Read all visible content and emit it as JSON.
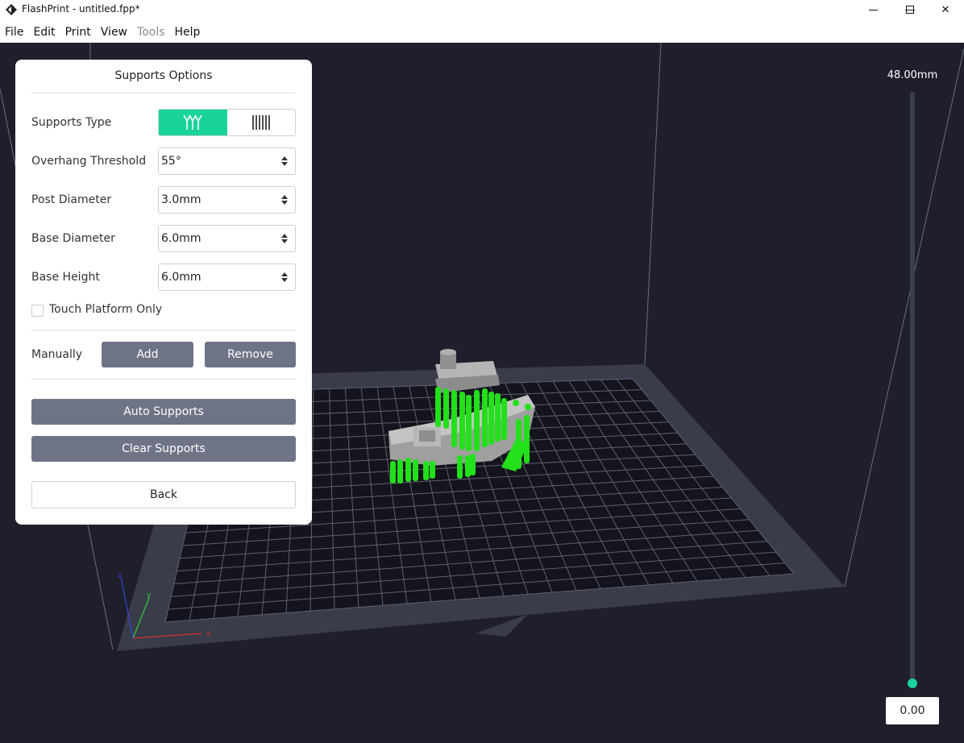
{
  "window": {
    "title": "FlashPrint - untitled.fpp*",
    "app_icon": "flashprint-logo-icon",
    "controls": {
      "minimize": "—",
      "maximize": "☐",
      "close": "✕"
    }
  },
  "menu": [
    {
      "label": "File",
      "enabled": true
    },
    {
      "label": "Edit",
      "enabled": true
    },
    {
      "label": "Print",
      "enabled": true
    },
    {
      "label": "View",
      "enabled": true
    },
    {
      "label": "Tools",
      "enabled": false
    },
    {
      "label": "Help",
      "enabled": true
    }
  ],
  "supports_panel": {
    "title": "Supports Options",
    "supports_type": {
      "label": "Supports Type",
      "options": [
        {
          "icon": "tree-supports-icon",
          "selected": true
        },
        {
          "icon": "linear-supports-icon",
          "selected": false
        }
      ]
    },
    "overhang_threshold": {
      "label": "Overhang Threshold",
      "value": "55°"
    },
    "post_diameter": {
      "label": "Post Diameter",
      "value": "3.0mm"
    },
    "base_diameter": {
      "label": "Base Diameter",
      "value": "6.0mm"
    },
    "base_height": {
      "label": "Base Height",
      "value": "6.0mm"
    },
    "touch_platform_only": {
      "label": "Touch Platform Only",
      "checked": false
    },
    "manually": {
      "label": "Manually",
      "add": "Add",
      "remove": "Remove"
    },
    "auto_supports": "Auto Supports",
    "clear_supports": "Clear Supports",
    "back": "Back"
  },
  "layer_slider": {
    "max_label": "48.00mm",
    "current_value": "0.00",
    "position_fraction": 0
  },
  "axes": {
    "x": "x",
    "y": "y",
    "z": "z"
  },
  "colors": {
    "accent": "#1ad39a",
    "viewport_bg": "#1f1f2b",
    "build_plate": "#3a3c4a",
    "grid_cells": "#14141c",
    "grid_lines": "#5d6072",
    "model": "#a8a8a8",
    "supports": "#22e01a",
    "button": "#6f7386"
  }
}
